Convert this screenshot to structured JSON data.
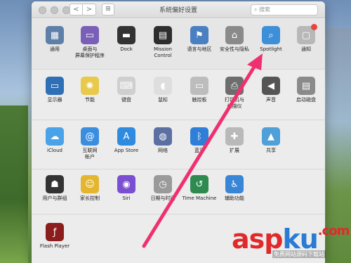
{
  "window": {
    "title": "系统偏好设置",
    "search_placeholder": "搜索",
    "nav_back": "<",
    "nav_forward": ">",
    "grid_glyph": "⊞"
  },
  "rows": [
    [
      {
        "id": "general",
        "label": "通用",
        "icon": "general-icon",
        "glyph": "▦",
        "color": "#5d7fa8"
      },
      {
        "id": "desktop",
        "label": "桌面与\n屏幕保护程序",
        "icon": "desktop-icon",
        "glyph": "▭",
        "color": "#7a5fb8"
      },
      {
        "id": "dock",
        "label": "Dock",
        "icon": "dock-icon",
        "glyph": "▬",
        "color": "#333333"
      },
      {
        "id": "mission",
        "label": "Mission\nControl",
        "icon": "mission-control-icon",
        "glyph": "▤",
        "color": "#2e2e2e"
      },
      {
        "id": "language",
        "label": "语言与地区",
        "icon": "flag-icon",
        "glyph": "⚑",
        "color": "#4a7fc1"
      },
      {
        "id": "security",
        "label": "安全性与隐私",
        "icon": "house-icon",
        "glyph": "⌂",
        "color": "#8a8a8a"
      },
      {
        "id": "spotlight",
        "label": "Spotlight",
        "icon": "spotlight-icon",
        "glyph": "⌕",
        "color": "#3d8fd8"
      },
      {
        "id": "notifications",
        "label": "通知",
        "icon": "notifications-icon",
        "glyph": "▢",
        "color": "#b8b8b8",
        "badge": true
      }
    ],
    [
      {
        "id": "displays",
        "label": "显示器",
        "icon": "display-icon",
        "glyph": "▭",
        "color": "#2f6fb6"
      },
      {
        "id": "energy",
        "label": "节能",
        "icon": "bulb-icon",
        "glyph": "✺",
        "color": "#e9c94a"
      },
      {
        "id": "keyboard",
        "label": "键盘",
        "icon": "keyboard-icon",
        "glyph": "⌨",
        "color": "#cfcfcf"
      },
      {
        "id": "mouse",
        "label": "鼠标",
        "icon": "mouse-icon",
        "glyph": "◖",
        "color": "#dedede"
      },
      {
        "id": "trackpad",
        "label": "触控板",
        "icon": "trackpad-icon",
        "glyph": "▭",
        "color": "#bdbdbd"
      },
      {
        "id": "printers",
        "label": "打印机与\n扫描仪",
        "icon": "printer-icon",
        "glyph": "⎙",
        "color": "#6d6d6d"
      },
      {
        "id": "sound",
        "label": "声音",
        "icon": "speaker-icon",
        "glyph": "◀",
        "color": "#555555"
      },
      {
        "id": "startup",
        "label": "启动磁盘",
        "icon": "disk-icon",
        "glyph": "▤",
        "color": "#8a8a8a"
      }
    ],
    [
      {
        "id": "icloud",
        "label": "iCloud",
        "icon": "icloud-icon",
        "glyph": "☁",
        "color": "#4aa3e8"
      },
      {
        "id": "internet",
        "label": "互联网\n帐户",
        "icon": "at-icon",
        "glyph": "@",
        "color": "#3a8ee0"
      },
      {
        "id": "appstore",
        "label": "App Store",
        "icon": "app-store-icon",
        "glyph": "A",
        "color": "#2f8be0"
      },
      {
        "id": "network",
        "label": "网络",
        "icon": "globe-icon",
        "glyph": "◍",
        "color": "#5b6fa3"
      },
      {
        "id": "bluetooth",
        "label": "蓝牙",
        "icon": "bluetooth-icon",
        "glyph": "ᛒ",
        "color": "#2f7fd8"
      },
      {
        "id": "extensions",
        "label": "扩展",
        "icon": "puzzle-icon",
        "glyph": "✚",
        "color": "#b9b9b9"
      },
      {
        "id": "sharing",
        "label": "共享",
        "icon": "folder-icon",
        "glyph": "▲",
        "color": "#4f9fd8"
      }
    ],
    [
      {
        "id": "users",
        "label": "用户与群组",
        "icon": "users-icon",
        "glyph": "☗",
        "color": "#333333"
      },
      {
        "id": "parental",
        "label": "家长控制",
        "icon": "parental-icon",
        "glyph": "☺",
        "color": "#e4b62f"
      },
      {
        "id": "siri",
        "label": "Siri",
        "icon": "siri-icon",
        "glyph": "◉",
        "color": "#7a4fd1"
      },
      {
        "id": "datetime",
        "label": "日期与时间",
        "icon": "clock-icon",
        "glyph": "◷",
        "color": "#9a9a9a"
      },
      {
        "id": "timemachine",
        "label": "Time Machine",
        "icon": "time-machine-icon",
        "glyph": "↺",
        "color": "#2e8a4f"
      },
      {
        "id": "accessibility",
        "label": "辅助功能",
        "icon": "accessibility-icon",
        "glyph": "♿",
        "color": "#3a86d6"
      }
    ],
    [
      {
        "id": "flash",
        "label": "Flash Player",
        "icon": "flash-icon",
        "glyph": "ƒ",
        "color": "#8b1d1d"
      }
    ]
  ],
  "watermark": {
    "part1": "asp",
    "part2": "ku",
    "part3": ".com",
    "sub": "免费网站源码下载站"
  },
  "colors": {
    "arrow": "#f0306e",
    "watermark_red": "#e02a2a",
    "watermark_blue": "#2a7bd6"
  }
}
